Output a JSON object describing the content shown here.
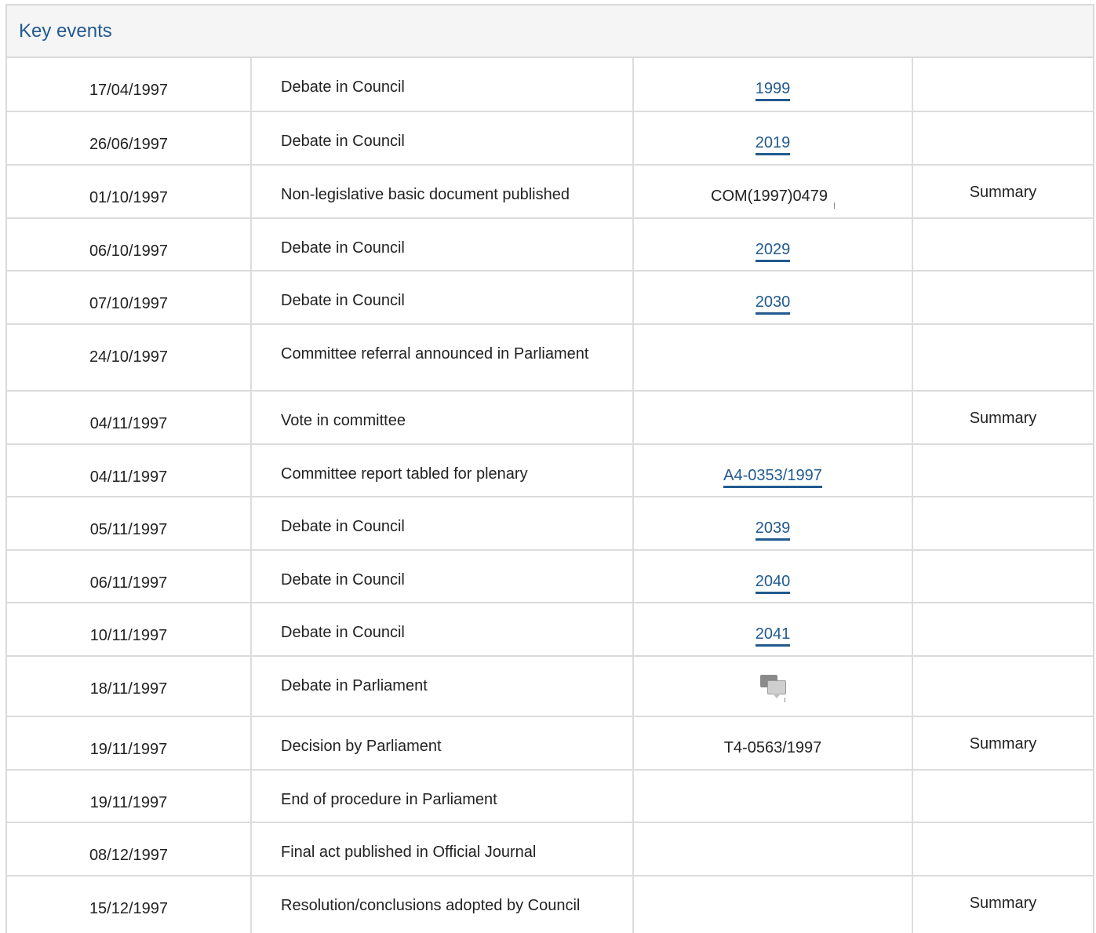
{
  "panel": {
    "title": "Key events"
  },
  "rows": [
    {
      "date": "17/04/1997",
      "event": "Debate in Council",
      "ref": "1999",
      "ref_type": "link",
      "summary": ""
    },
    {
      "date": "26/06/1997",
      "event": "Debate in Council",
      "ref": "2019",
      "ref_type": "link",
      "summary": ""
    },
    {
      "date": "01/10/1997",
      "event": "Non-legislative basic document published",
      "ref": "COM(1997)0479",
      "ref_type": "external",
      "summary": "Summary"
    },
    {
      "date": "06/10/1997",
      "event": "Debate in Council",
      "ref": "2029",
      "ref_type": "link",
      "summary": ""
    },
    {
      "date": "07/10/1997",
      "event": "Debate in Council",
      "ref": "2030",
      "ref_type": "link",
      "summary": ""
    },
    {
      "date": "24/10/1997",
      "event": "Committee referral announced in Parliament",
      "ref": "",
      "ref_type": "none",
      "summary": ""
    },
    {
      "date": "04/11/1997",
      "event": "Vote in committee",
      "ref": "",
      "ref_type": "none",
      "summary": "Summary"
    },
    {
      "date": "04/11/1997",
      "event": "Committee report tabled for plenary",
      "ref": "A4-0353/1997",
      "ref_type": "link",
      "summary": ""
    },
    {
      "date": "05/11/1997",
      "event": "Debate in Council",
      "ref": "2039",
      "ref_type": "link",
      "summary": ""
    },
    {
      "date": "06/11/1997",
      "event": "Debate in Council",
      "ref": "2040",
      "ref_type": "link",
      "summary": ""
    },
    {
      "date": "10/11/1997",
      "event": "Debate in Council",
      "ref": "2041",
      "ref_type": "link",
      "summary": ""
    },
    {
      "date": "18/11/1997",
      "event": "Debate in Parliament",
      "ref": "",
      "ref_type": "icon",
      "icon": "debate-speech-bubbles-icon",
      "summary": ""
    },
    {
      "date": "19/11/1997",
      "event": "Decision by Parliament",
      "ref": "T4-0563/1997",
      "ref_type": "text",
      "summary": "Summary"
    },
    {
      "date": "19/11/1997",
      "event": "End of procedure in Parliament",
      "ref": "",
      "ref_type": "none",
      "summary": ""
    },
    {
      "date": "08/12/1997",
      "event": "Final act published in Official Journal",
      "ref": "",
      "ref_type": "none",
      "summary": ""
    },
    {
      "date": "15/12/1997",
      "event": "Resolution/conclusions adopted by Council",
      "ref": "",
      "ref_type": "none",
      "summary": "Summary"
    }
  ],
  "colors": {
    "accent": "#215a8f",
    "border": "#dcdcdc",
    "header_bg": "#f5f5f5"
  }
}
